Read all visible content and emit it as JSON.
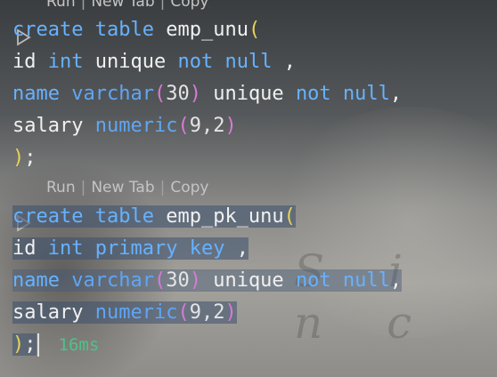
{
  "codelens": {
    "top": {
      "run": "Run",
      "new_tab": "New Tab",
      "copy": "Copy",
      "sep": "|"
    },
    "bottom": {
      "run": "Run",
      "new_tab": "New Tab",
      "copy": "Copy",
      "sep": "|"
    }
  },
  "block1": {
    "l1": {
      "kw1": "create",
      "kw2": "table",
      "name": "emp_unu",
      "paren": "("
    },
    "l2": {
      "col": "id",
      "type": "int",
      "kw1": "unique",
      "kw2": "not",
      "kw3": "null",
      "tail": ","
    },
    "l3": {
      "col": "name",
      "type": "varchar",
      "open": "(",
      "size": "30",
      "close": ")",
      "kw1": "unique",
      "kw2": "not",
      "kw3": "null",
      "tail": ","
    },
    "l4": {
      "col": "salary",
      "type": "numeric",
      "open": "(",
      "args": "9,2",
      "close": ")"
    },
    "l5": {
      "close": ")",
      "semi": ";"
    }
  },
  "block2": {
    "l1": {
      "kw1": "create",
      "kw2": "table",
      "name": "emp_pk_unu",
      "paren": "("
    },
    "l2": {
      "col": "id",
      "type": "int",
      "kw1": "primary",
      "kw2": "key",
      "tail": ","
    },
    "l3": {
      "col": "name",
      "type": "varchar",
      "open": "(",
      "size": "30",
      "close": ")",
      "kw1": "unique",
      "kw2": "not",
      "kw3": "null",
      "tail": ","
    },
    "l4": {
      "col": "salary",
      "type": "numeric",
      "open": "(",
      "args": "9,2",
      "close": ")"
    },
    "l5": {
      "close": ")",
      "semi": ";",
      "timing": "16ms"
    }
  },
  "watermark": "S i n c",
  "colors": {
    "keyword": "#66b2ff",
    "paren": "#e7d35a",
    "inner_paren": "#d77bd8",
    "timing": "#4ec28a"
  }
}
